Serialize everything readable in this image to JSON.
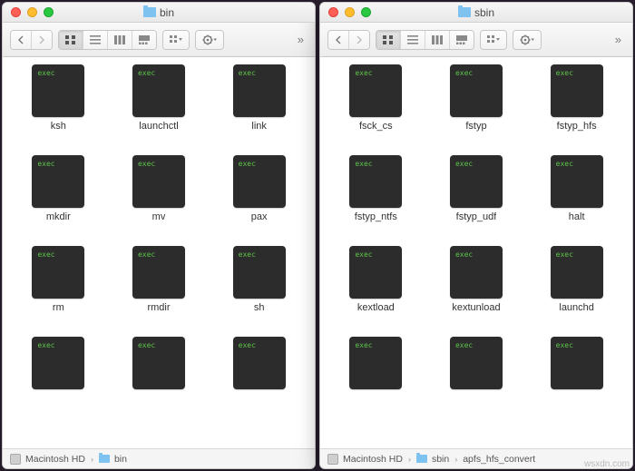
{
  "windows": [
    {
      "title": "bin",
      "files": [
        "ksh",
        "launchctl",
        "link",
        "mkdir",
        "mv",
        "pax",
        "rm",
        "rmdir",
        "sh",
        "",
        "",
        ""
      ],
      "path": [
        "Macintosh HD",
        "bin"
      ]
    },
    {
      "title": "sbin",
      "files": [
        "fsck_cs",
        "fstyp",
        "fstyp_hfs",
        "fstyp_ntfs",
        "fstyp_udf",
        "halt",
        "kextload",
        "kextunload",
        "launchd",
        "",
        "",
        ""
      ],
      "path": [
        "Macintosh HD",
        "sbin",
        "apfs_hfs_convert"
      ]
    }
  ],
  "watermark": "wsxdn.com"
}
